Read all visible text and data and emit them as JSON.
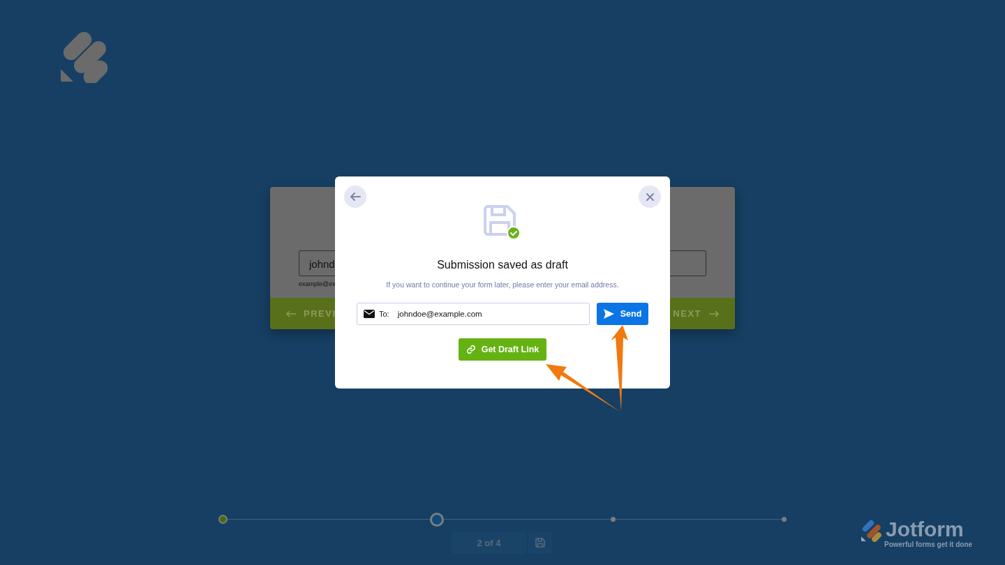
{
  "background_form": {
    "email_value": "johnd",
    "email_hint": "example@ex",
    "previous_button": "PREVI",
    "next_button": "NEXT"
  },
  "modal": {
    "title": "Submission saved as draft",
    "message": "If you want to continue your form later, please enter your email address.",
    "to_label": "To:",
    "email_value": "johndoe@example.com",
    "send_button": "Send",
    "draft_link_button": "Get Draft Link"
  },
  "progress": {
    "steps": [
      {
        "completed": true,
        "selected": false
      },
      {
        "completed": false,
        "selected": true
      },
      {
        "completed": false,
        "selected": false
      },
      {
        "completed": false,
        "selected": false
      }
    ],
    "page_indicator": "2 of 4"
  },
  "branding": {
    "name": "Jotform",
    "tagline": "Powerful forms get it done"
  }
}
